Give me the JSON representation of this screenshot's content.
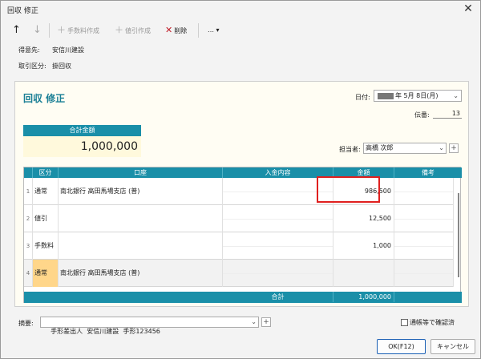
{
  "window": {
    "title": "回収 修正",
    "close": "✕"
  },
  "toolbar": {
    "up": "↑",
    "down": "↓",
    "fee_create": "手数料作成",
    "discount_create": "値引作成",
    "delete": "削除",
    "more": "…",
    "more_arrow": "▾"
  },
  "info": {
    "customer_label": "得意先:",
    "customer_value": "安信川建設",
    "txn_label": "取引区分:",
    "txn_value": "掛回収"
  },
  "form": {
    "heading": "回収 修正",
    "date_label": "日付:",
    "date_value": "年 5月 8日(月)",
    "denpyo_label": "伝番:",
    "denpyo_value": "13",
    "total_label": "合計金額",
    "total_value": "1,000,000",
    "tanto_label": "担当者:",
    "tanto_value": "高橋 次郎"
  },
  "grid": {
    "headers": [
      "区分",
      "口座",
      "入金内容",
      "金額",
      "備考"
    ],
    "rows": [
      {
        "num": "1",
        "kubun": "通常",
        "koza": "南北銀行 高田馬場支店 (普)",
        "amount": "986,500"
      },
      {
        "num": "2",
        "kubun": "値引",
        "koza": "",
        "amount": "12,500"
      },
      {
        "num": "3",
        "kubun": "手数料",
        "koza": "",
        "amount": "1,000"
      },
      {
        "num": "4",
        "kubun": "通常",
        "koza": "南北銀行 高田馬場支店 (普)",
        "amount": ""
      }
    ],
    "footer_label": "合計",
    "footer_value": "1,000,000"
  },
  "tekiyo": {
    "label": "摘要:",
    "value": "手形差出人  安信川建設  手形123456"
  },
  "confirm_label": "通帳等で確認済",
  "buttons": {
    "ok": "OK(F12)",
    "cancel": "キャンセル"
  },
  "colors": {
    "accent": "#1a8fa8",
    "highlight": "#e0201f",
    "title": "#1a7f95"
  }
}
